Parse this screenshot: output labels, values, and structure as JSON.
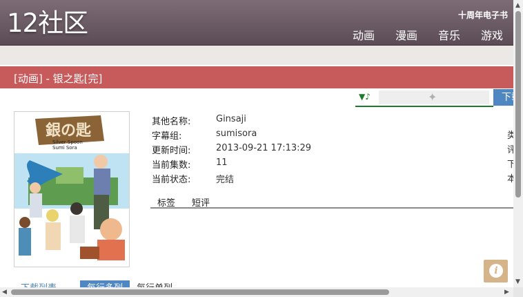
{
  "header": {
    "logo": "12社区",
    "tagline": "十周年电子书",
    "nav": [
      "动画",
      "漫画",
      "音乐",
      "游戏"
    ]
  },
  "title": "[动画] - 银之匙[完]",
  "player": {
    "icon": "music-note-icon",
    "plugin_icon": "puzzle-piece-icon"
  },
  "download_button": "下载",
  "poster": {
    "logo_text": "銀の匙",
    "subtitle_lines": [
      "Silver Spoon",
      "Sumi Sora"
    ]
  },
  "info": [
    {
      "label": "其他名称:",
      "value": "Ginsaji",
      "side": "类"
    },
    {
      "label": "字幕组:",
      "value": "sumisora",
      "side": "评"
    },
    {
      "label": "更新时间:",
      "value": "2013-09-21 17:13:29",
      "side": "下"
    },
    {
      "label": "当前集数:",
      "value": "11",
      "side": "本"
    },
    {
      "label": "当前状态:",
      "value": "完结",
      "side": ""
    }
  ],
  "tabs": [
    "标签",
    "短评"
  ],
  "bottom_tabs": [
    "下载列表",
    "每行多列",
    "每行单列"
  ],
  "colors": {
    "header": "#6b5a64",
    "title_bar": "#c75b5b",
    "link_blue": "#4f87c2",
    "player_green": "#1b7a2b",
    "info_button": "#d6b48a"
  }
}
